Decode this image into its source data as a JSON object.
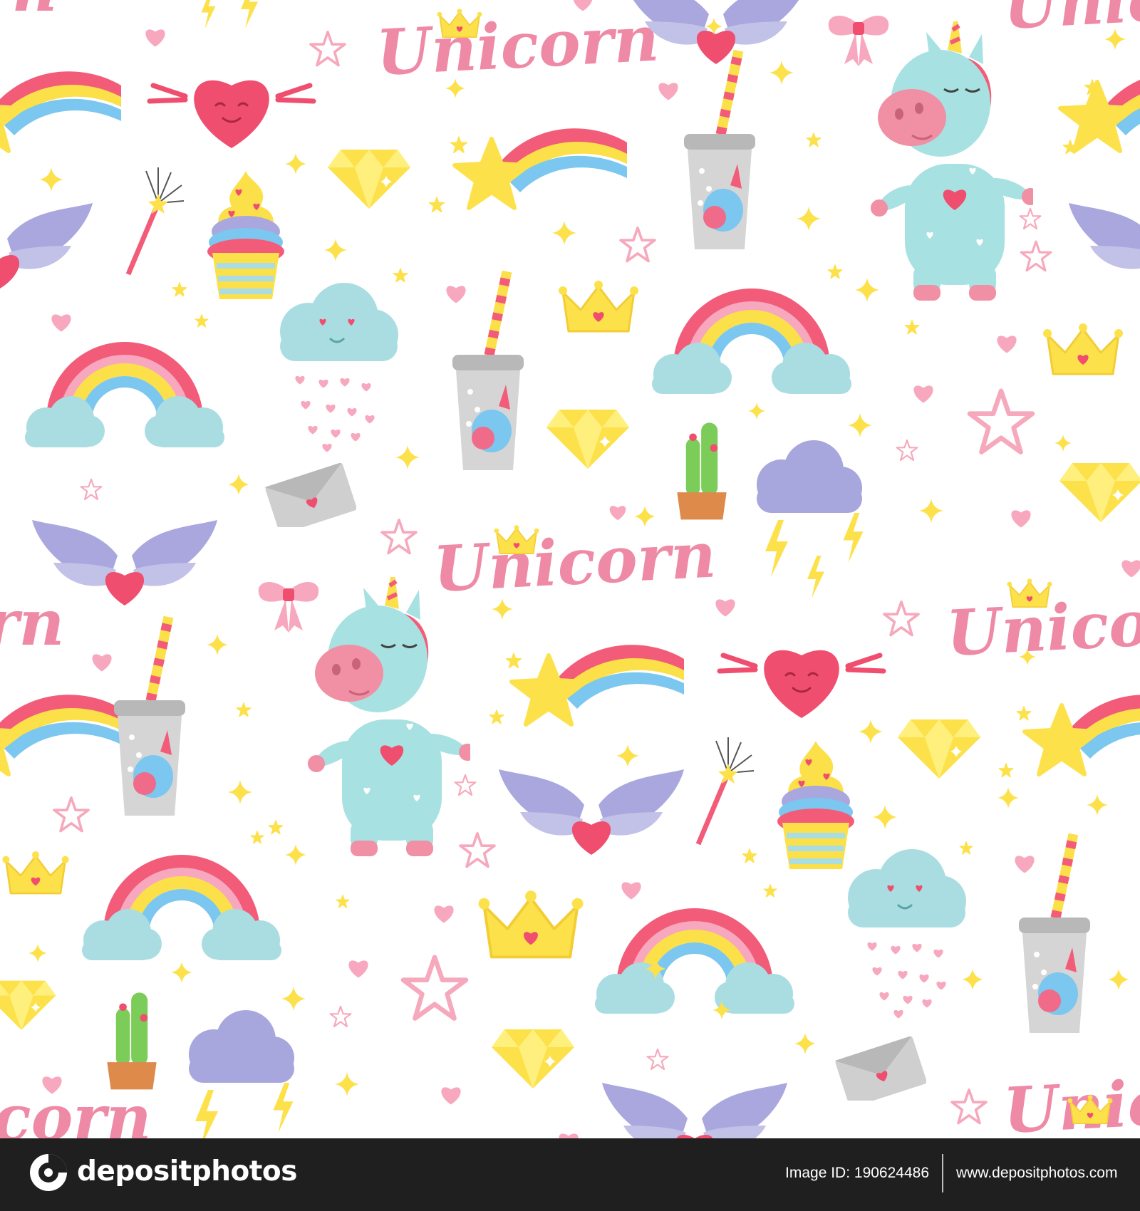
{
  "pattern": {
    "word": "Unicorn",
    "colors": {
      "background": "#ffffff",
      "pink": "#f06b8a",
      "text_pink": "#ef8aa6",
      "rainbow_red": "#f25c79",
      "rainbow_yellow": "#fbe04a",
      "rainbow_blue": "#7cc7ef",
      "cloud_blue": "#a9dde2",
      "cloud_purple": "#a7a6dd",
      "wing": "#a9a7dd",
      "heart": "#f04e6e",
      "gold": "#fde14b",
      "unicorn_body": "#a8e1e2",
      "unicorn_face": "#f18fa4",
      "cup": "#cfcfcf",
      "cactus": "#7ccc59",
      "pot": "#dd8a4b"
    },
    "icons": [
      "unicorn-icon",
      "rainbow-icon",
      "shooting-star-icon",
      "heart-icon",
      "winged-heart-icon",
      "crown-icon",
      "diamond-icon",
      "cupcake-icon",
      "cup-with-straw-icon",
      "cloud-icon",
      "lightning-icon",
      "cactus-icon",
      "envelope-icon",
      "bow-icon",
      "magic-wand-icon",
      "star-icon",
      "sparkle-icon"
    ]
  },
  "footer": {
    "brand": "depositphotos",
    "image_id": "Image ID: 190624486",
    "url": "www.depositphotos.com",
    "colors": {
      "bar": "#1f1f1f",
      "text": "#ffffff"
    }
  }
}
